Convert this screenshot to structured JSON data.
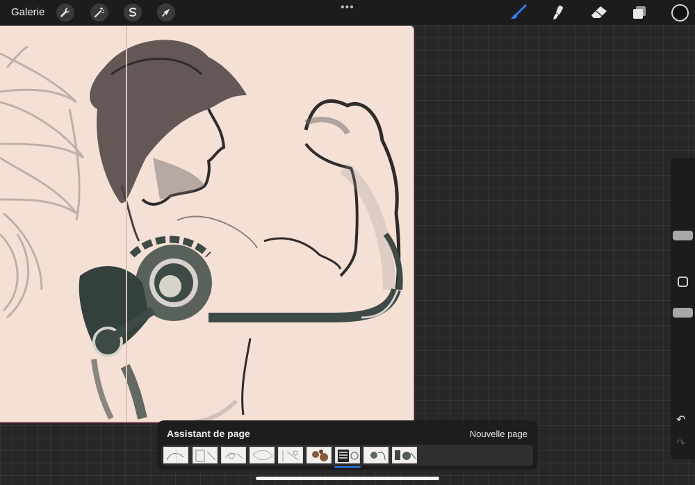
{
  "topbar": {
    "gallery_label": "Galerie",
    "tools_left": [
      "wrench-icon",
      "magic-wand-icon",
      "selection-icon",
      "transform-arrow-icon"
    ],
    "more_label": "•••",
    "tools_right": [
      "brush-icon",
      "smudge-icon",
      "eraser-icon",
      "layers-icon"
    ],
    "active_tool": "brush-icon",
    "accent_color": "#2f7cf6",
    "current_color": "#111111"
  },
  "canvas": {
    "paper_color": "#f5e0d6",
    "ink_color": "#2f2b2b",
    "mech_color": "#3d4a45"
  },
  "sidebar": {
    "brush_size_icon": "slider-handle",
    "opacity_icon": "slider-handle",
    "modify_icon": "square-icon",
    "undo_icon": "undo-icon",
    "redo_icon": "redo-icon"
  },
  "page_assistant": {
    "title": "Assistant de page",
    "new_page_label": "Nouvelle page",
    "page_count": 9,
    "active_page": 7
  }
}
